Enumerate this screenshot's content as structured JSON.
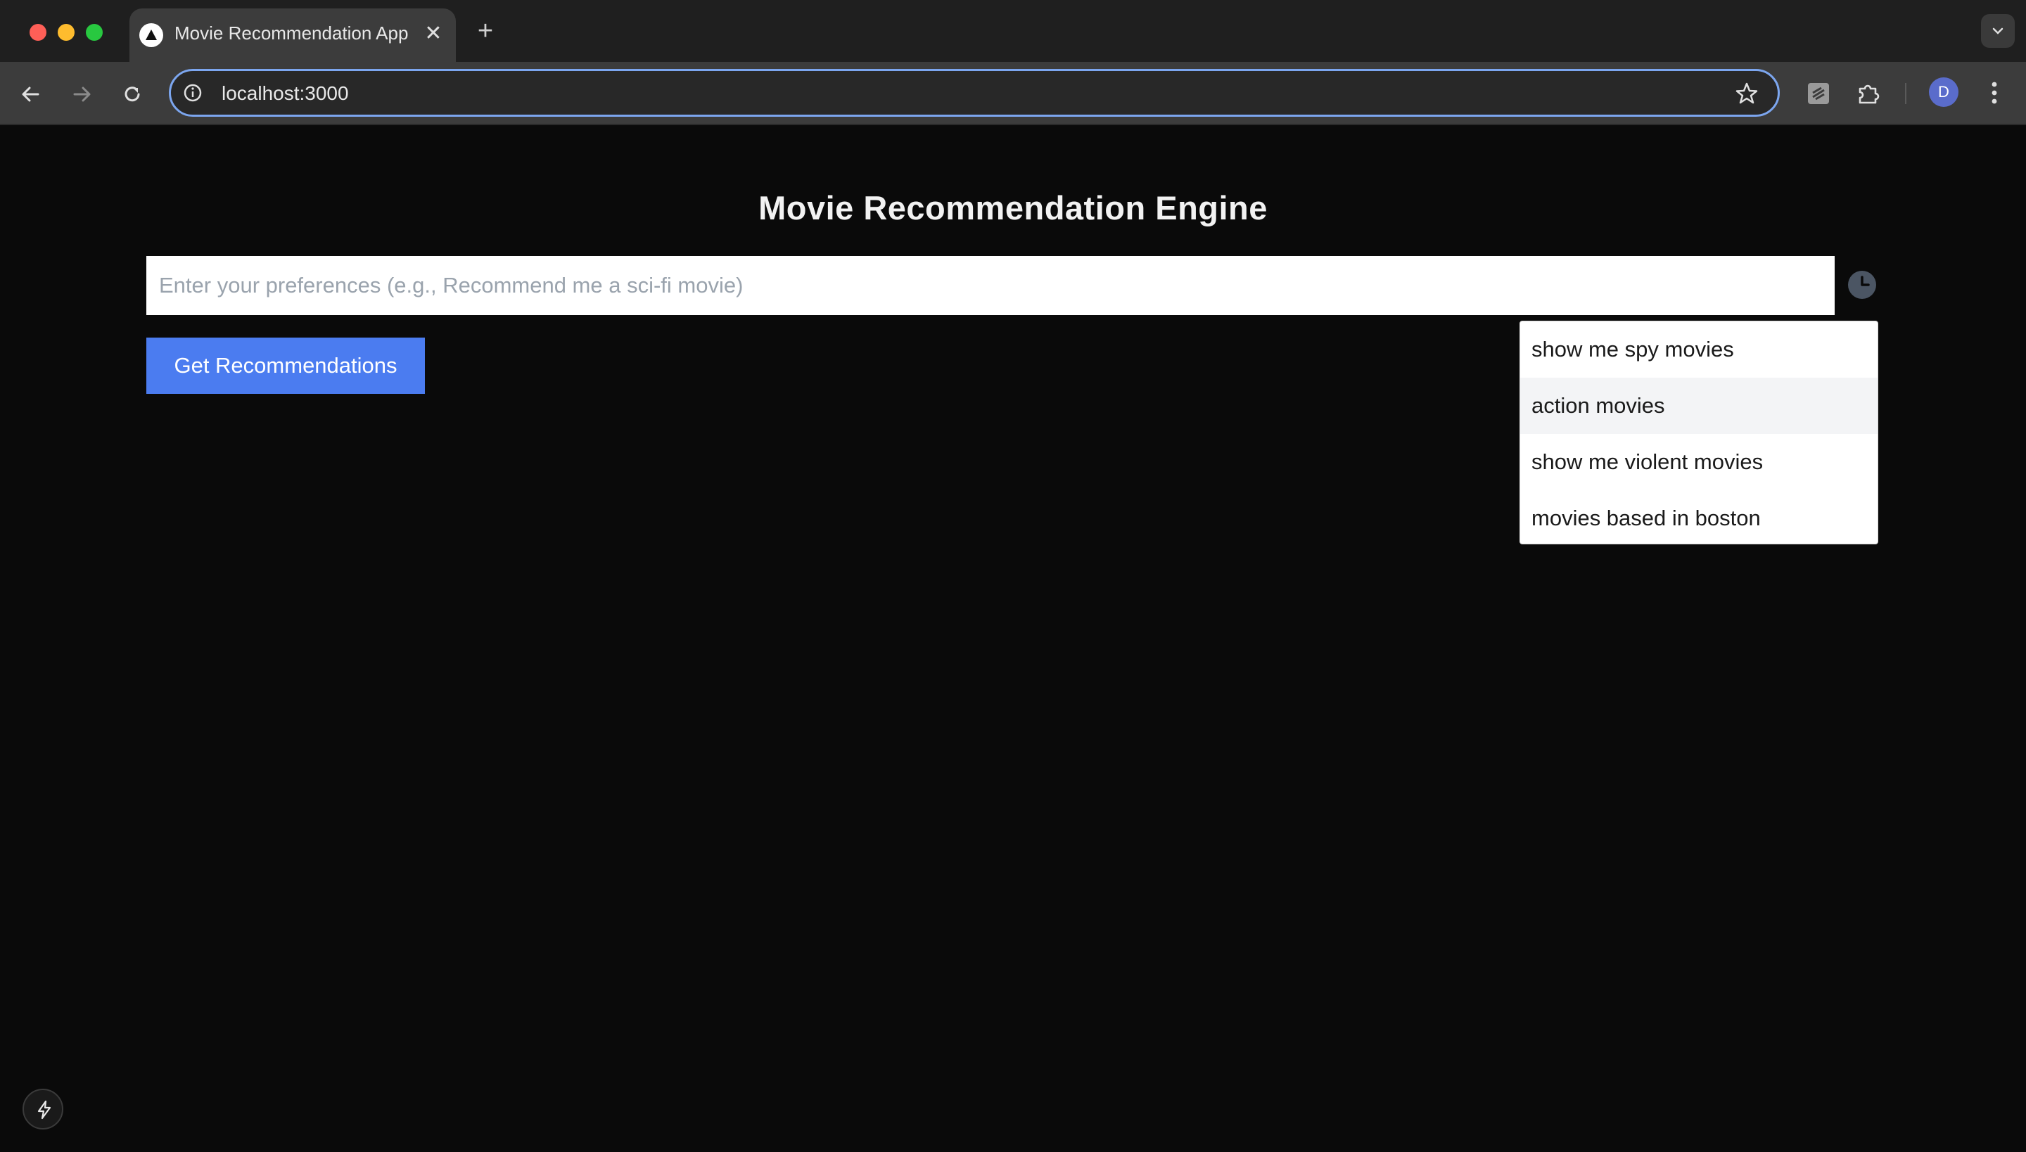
{
  "browser": {
    "tab_title": "Movie Recommendation App",
    "tab_close_glyph": "✕",
    "new_tab_glyph": "+",
    "url": "localhost:3000",
    "profile_initial": "D"
  },
  "page": {
    "title": "Movie Recommendation Engine",
    "input": {
      "value": "",
      "placeholder": "Enter your preferences (e.g., Recommend me a sci-fi movie)"
    },
    "button_label": "Get Recommendations",
    "history_suggestions": [
      "show me spy movies",
      "action movies",
      "show me violent movies",
      "movies based in boston"
    ],
    "hovered_suggestion_index": 1
  },
  "colors": {
    "accent": "#4b7cf0",
    "background": "#0a0a0a",
    "omnibox_focus": "#7ca6ef"
  },
  "icons": [
    "back-arrow-icon",
    "forward-arrow-icon",
    "reload-icon",
    "info-icon",
    "star-icon",
    "extension-icon",
    "puzzle-icon",
    "more-vert-icon",
    "clock-icon",
    "lightning-icon",
    "chevron-down-icon",
    "triangle-logo-icon"
  ]
}
